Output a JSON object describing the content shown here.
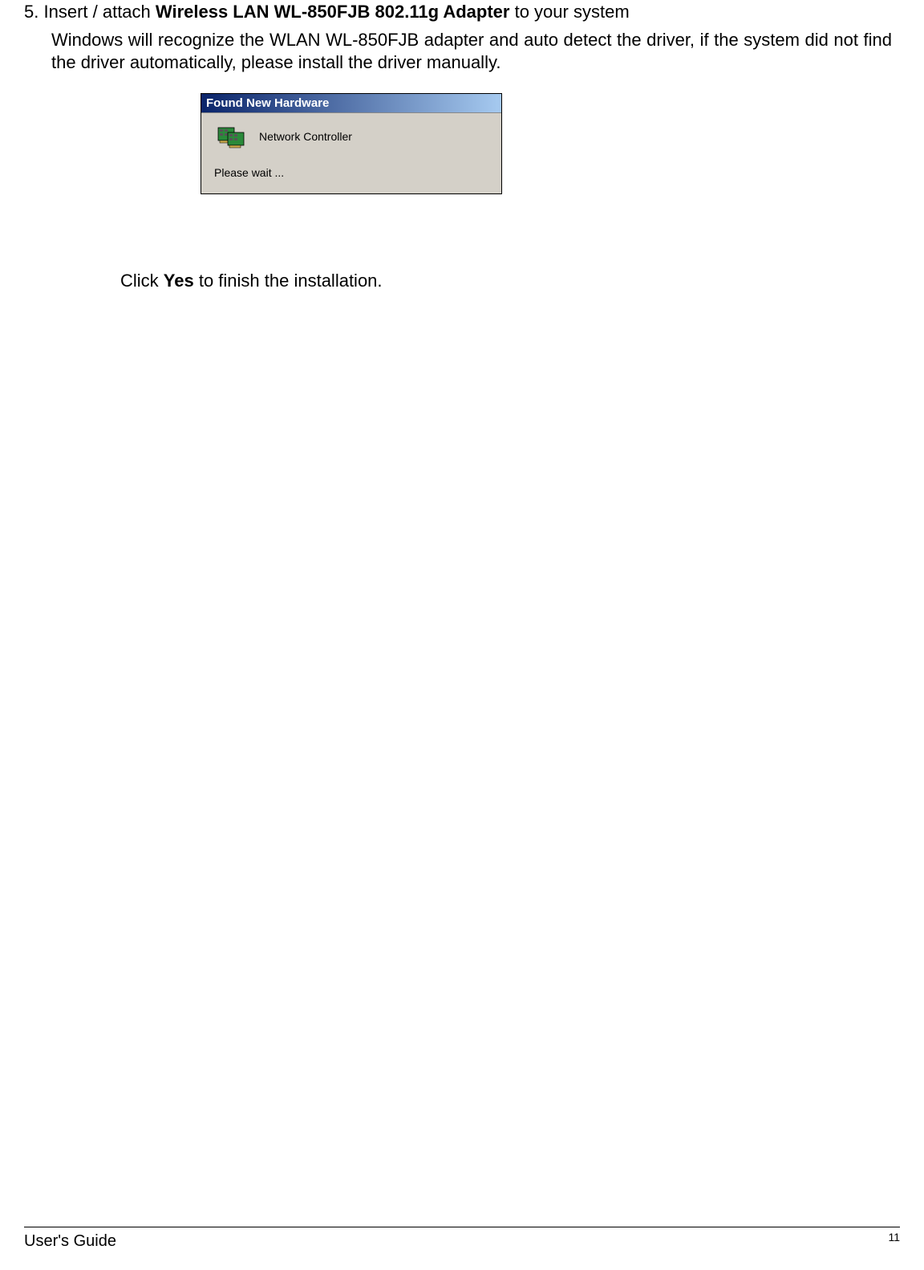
{
  "step": {
    "number": "5.",
    "prefix": "Insert / attach ",
    "product_bold": "Wireless LAN WL-850FJB 802.11g Adapter",
    "suffix": " to your system"
  },
  "body_paragraph": "Windows will recognize the WLAN WL-850FJB adapter and auto detect the driver, if the system did not find the driver automatically, please install the driver manually.",
  "dialog": {
    "title": "Found New Hardware",
    "device_label": "Network Controller",
    "wait_text": "Please wait ..."
  },
  "instruction": {
    "prefix": "Click ",
    "bold": "Yes",
    "suffix": " to finish the installation."
  },
  "footer": {
    "guide_label": "User's Guide",
    "page_number": "11"
  }
}
